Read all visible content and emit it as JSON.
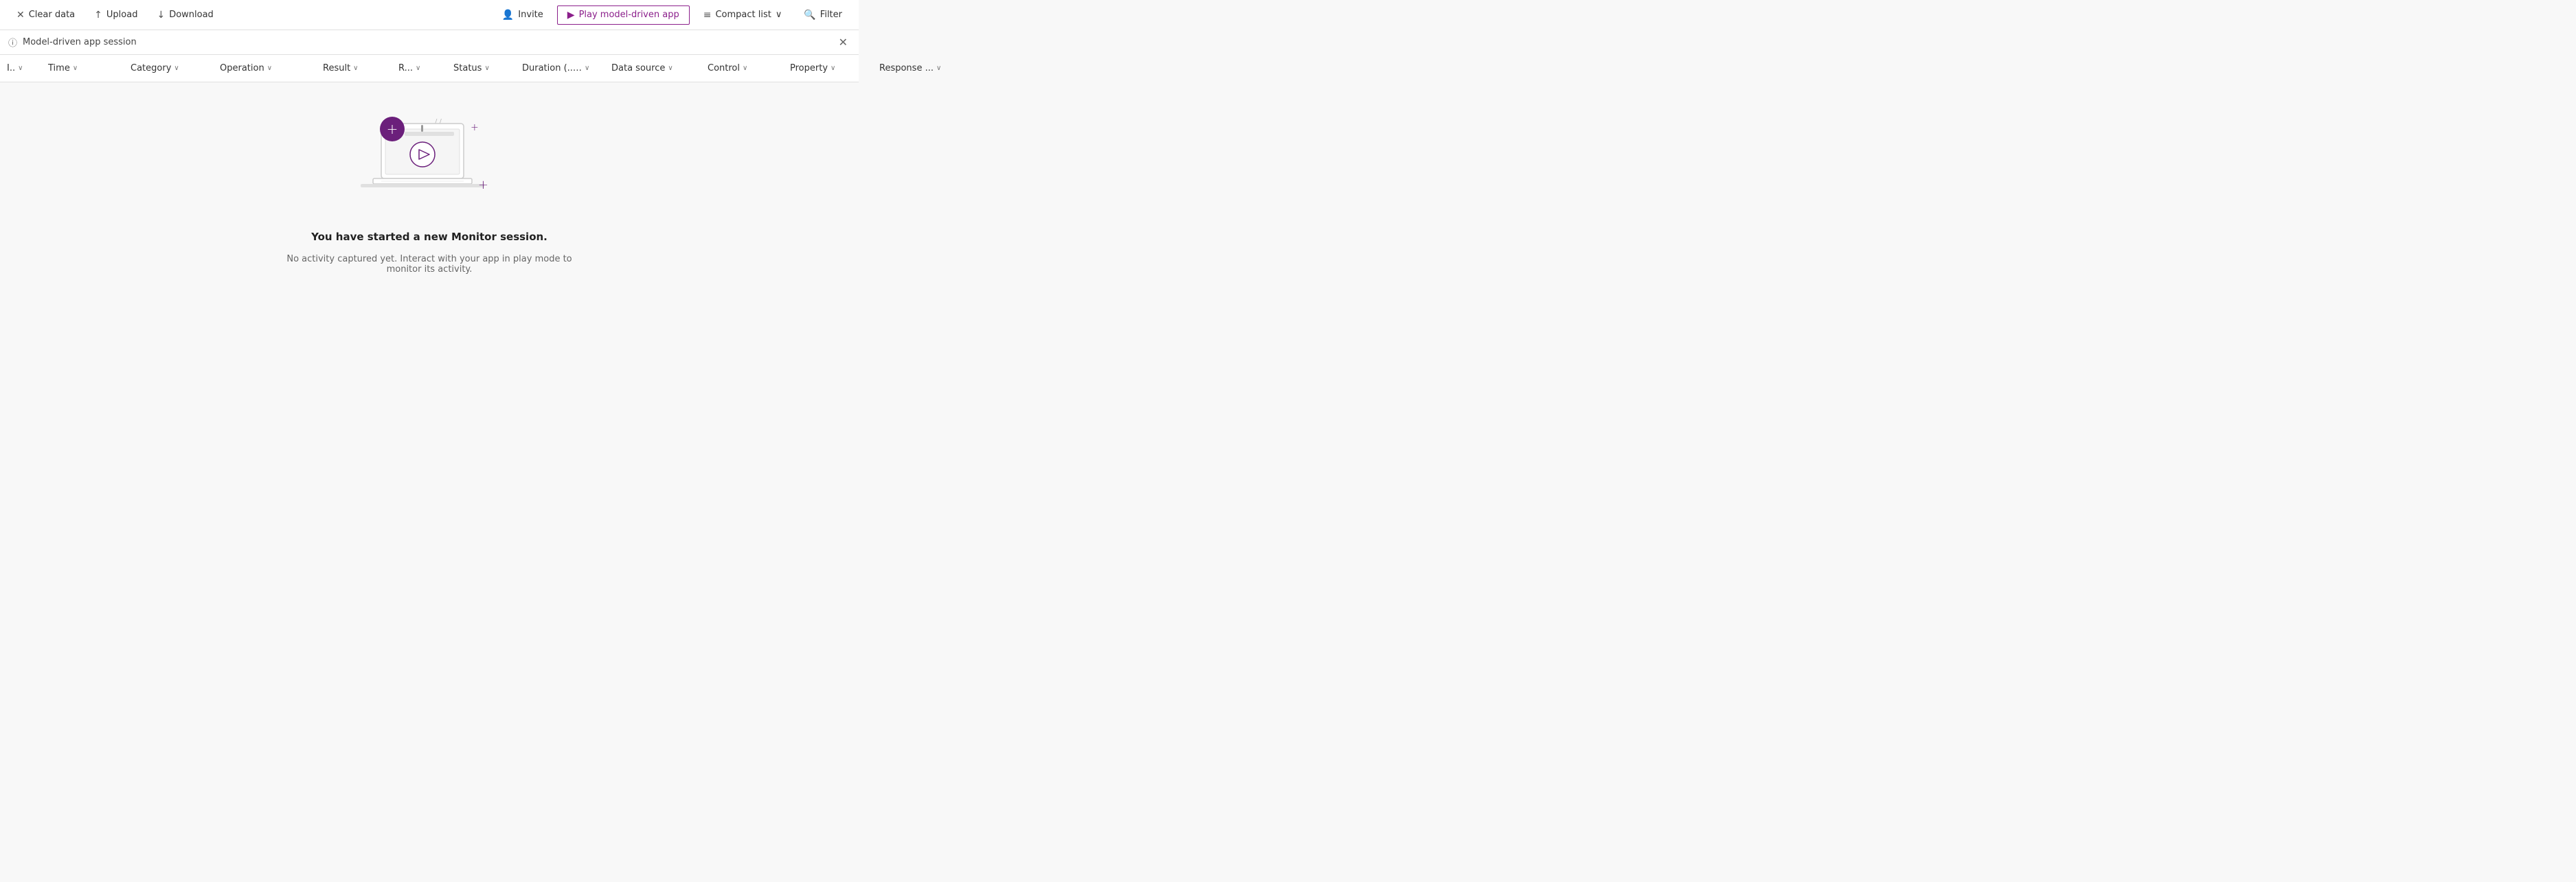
{
  "toolbar": {
    "clear_data_label": "Clear data",
    "upload_label": "Upload",
    "download_label": "Download",
    "invite_label": "Invite",
    "play_app_label": "Play model-driven app",
    "compact_list_label": "Compact list",
    "filter_label": "Filter"
  },
  "session_bar": {
    "label": "Model-driven app session"
  },
  "columns": [
    {
      "id": "col-id",
      "label": "I..",
      "sortable": true
    },
    {
      "id": "col-time",
      "label": "Time",
      "sortable": true
    },
    {
      "id": "col-category",
      "label": "Category",
      "sortable": true
    },
    {
      "id": "col-operation",
      "label": "Operation",
      "sortable": true
    },
    {
      "id": "col-result",
      "label": "Result",
      "sortable": true
    },
    {
      "id": "col-r",
      "label": "R...",
      "sortable": true
    },
    {
      "id": "col-status",
      "label": "Status",
      "sortable": true
    },
    {
      "id": "col-duration",
      "label": "Duration (..…",
      "sortable": true
    },
    {
      "id": "col-datasource",
      "label": "Data source",
      "sortable": true
    },
    {
      "id": "col-control",
      "label": "Control",
      "sortable": true
    },
    {
      "id": "col-property",
      "label": "Property",
      "sortable": true
    },
    {
      "id": "col-response",
      "label": "Response ...",
      "sortable": true
    }
  ],
  "empty_state": {
    "title": "You have started a new Monitor session.",
    "subtitle": "No activity captured yet. Interact with your app in play mode to monitor its activity."
  },
  "icons": {
    "close": "✕",
    "clear": "✕",
    "upload": "↑",
    "download": "↓",
    "invite": "👤",
    "play": "▶",
    "compact_list": "≡",
    "filter": "🔍",
    "info": "ⓘ",
    "chevron": "∨",
    "plus": "+"
  }
}
